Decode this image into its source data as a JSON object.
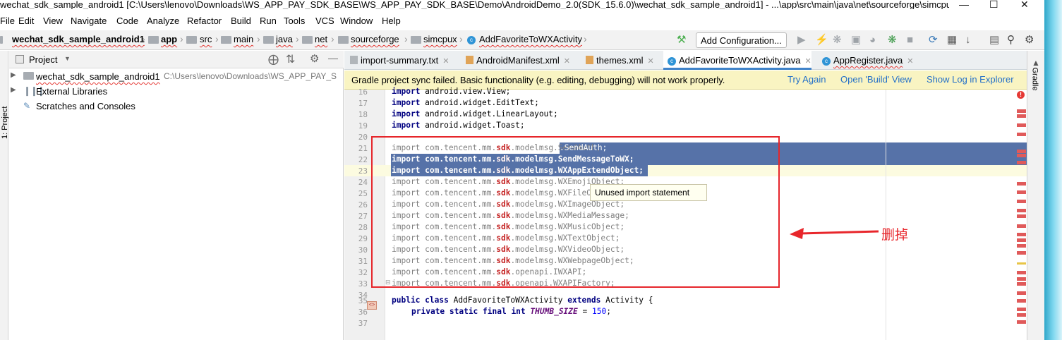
{
  "window": {
    "title": "wechat_sdk_sample_android1 [C:\\Users\\lenovo\\Downloads\\WS_APP_PAY_SDK_BASE\\WS_APP_PAY_SDK_BASE\\Demo\\AndroidDemo_2.0(SDK_15.6.0)\\wechat_sdk_sample_android1] - ...\\app\\src\\main\\java\\net\\sourceforge\\simcpu..."
  },
  "menu": [
    "File",
    "Edit",
    "View",
    "Navigate",
    "Code",
    "Analyze",
    "Refactor",
    "Build",
    "Run",
    "Tools",
    "VCS",
    "Window",
    "Help"
  ],
  "breadcrumb": [
    "wechat_sdk_sample_android1",
    "app",
    "src",
    "main",
    "java",
    "net",
    "sourceforge",
    "simcpux",
    "AddFavoriteToWXActivity"
  ],
  "toolbar": {
    "add_config": "Add Configuration..."
  },
  "project": {
    "header": "Project",
    "items": [
      {
        "label": "wechat_sdk_sample_android1",
        "path": "C:\\Users\\lenovo\\Downloads\\WS_APP_PAY_S"
      },
      {
        "label": "External Libraries"
      },
      {
        "label": "Scratches and Consoles"
      }
    ],
    "side_label": "1: Project"
  },
  "tabs": [
    "import-summary.txt",
    "AndroidManifest.xml",
    "themes.xml",
    "AddFavoriteToWXActivity.java",
    "AppRegister.java"
  ],
  "banner": {
    "message": "Gradle project sync failed. Basic functionality (e.g. editing, debugging) will not work properly.",
    "try_again": "Try Again",
    "open_build": "Open 'Build' View",
    "show_log": "Show Log in Explorer"
  },
  "editor": {
    "lines": [
      {
        "n": "16",
        "kw": "import",
        "pre": "android.view.View;",
        "sdk": "",
        "post": "",
        "unused": false
      },
      {
        "n": "17",
        "kw": "import",
        "pre": "android.widget.EditText;",
        "sdk": "",
        "post": "",
        "unused": false
      },
      {
        "n": "18",
        "kw": "import",
        "pre": "android.widget.LinearLayout;",
        "sdk": "",
        "post": "",
        "unused": false
      },
      {
        "n": "19",
        "kw": "import",
        "pre": "android.widget.Toast;",
        "sdk": "",
        "post": "",
        "unused": false
      },
      {
        "n": "20",
        "kw": "",
        "pre": "",
        "sdk": "",
        "post": "",
        "unused": false
      },
      {
        "n": "21",
        "kw": "import",
        "pre": "com.tencent.mm.",
        "sdk": "sdk",
        "post": ".modelmsg.SendAuth;",
        "unused": true
      },
      {
        "n": "22",
        "kw": "import",
        "pre": "com.tencent.mm.",
        "sdk": "sdk",
        "post": ".modelmsg.SendMessageToWX;",
        "unused": true
      },
      {
        "n": "23",
        "kw": "import",
        "pre": "com.tencent.mm.",
        "sdk": "sdk",
        "post": ".modelmsg.WXAppExtendObject;",
        "unused": true
      },
      {
        "n": "24",
        "kw": "import",
        "pre": "com.tencent.mm.",
        "sdk": "sdk",
        "post": ".modelmsg.WXEmojiObject;",
        "unused": true
      },
      {
        "n": "25",
        "kw": "import",
        "pre": "com.tencent.mm.",
        "sdk": "sdk",
        "post": ".modelmsg.WXFileObject;",
        "unused": true
      },
      {
        "n": "26",
        "kw": "import",
        "pre": "com.tencent.mm.",
        "sdk": "sdk",
        "post": ".modelmsg.WXImageObject;",
        "unused": true
      },
      {
        "n": "27",
        "kw": "import",
        "pre": "com.tencent.mm.",
        "sdk": "sdk",
        "post": ".modelmsg.WXMediaMessage;",
        "unused": true
      },
      {
        "n": "28",
        "kw": "import",
        "pre": "com.tencent.mm.",
        "sdk": "sdk",
        "post": ".modelmsg.WXMusicObject;",
        "unused": true
      },
      {
        "n": "29",
        "kw": "import",
        "pre": "com.tencent.mm.",
        "sdk": "sdk",
        "post": ".modelmsg.WXTextObject;",
        "unused": true
      },
      {
        "n": "30",
        "kw": "import",
        "pre": "com.tencent.mm.",
        "sdk": "sdk",
        "post": ".modelmsg.WXVideoObject;",
        "unused": true
      },
      {
        "n": "31",
        "kw": "import",
        "pre": "com.tencent.mm.",
        "sdk": "sdk",
        "post": ".modelmsg.WXWebpageObject;",
        "unused": true
      },
      {
        "n": "32",
        "kw": "import",
        "pre": "com.tencent.mm.",
        "sdk": "sdk",
        "post": ".openapi.IWXAPI;",
        "unused": true
      },
      {
        "n": "33",
        "kw": "import",
        "pre": "com.tencent.mm.",
        "sdk": "sdk",
        "post": ".openapi.WXAPIFactory;",
        "unused": true
      },
      {
        "n": "34",
        "kw": "",
        "pre": "",
        "sdk": "",
        "post": "",
        "unused": false
      },
      {
        "n": "35",
        "kw": "",
        "pre": "",
        "sdk": "",
        "post": "",
        "unused": false
      },
      {
        "n": "36",
        "kw": "",
        "pre": "",
        "sdk": "",
        "post": "",
        "unused": false
      },
      {
        "n": "37",
        "kw": "",
        "pre": "",
        "sdk": "",
        "post": "",
        "unused": false
      }
    ],
    "class_line": {
      "kw1": "public class",
      "name": "AddFavoriteToWXActivity",
      "kw2": "extends",
      "parent": "Activity {"
    },
    "field_line": {
      "kw": "private static final int",
      "name": "THUMB_SIZE",
      "rest": " = ",
      "num": "150",
      "end": ";"
    }
  },
  "tooltip": "Unused import statement",
  "annotation": "删掉",
  "gradle_label": "Gradle",
  "colors": {
    "accent": "#4083c9",
    "selection": "#5672a8",
    "annotation": "#e8262b",
    "banner": "#f9f4c2"
  }
}
